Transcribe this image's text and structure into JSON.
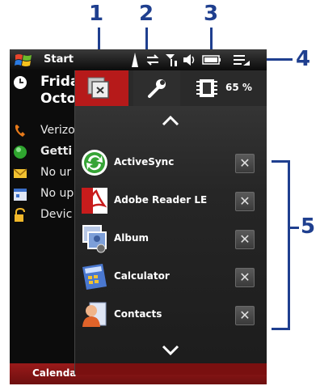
{
  "callouts": [
    "1",
    "2",
    "3",
    "4",
    "5"
  ],
  "statusbar": {
    "start_label": "Start"
  },
  "today": {
    "date_line1": "Frida",
    "date_line2": "Octo",
    "rows": [
      {
        "icon": "phone-icon",
        "text": "Verizo"
      },
      {
        "icon": "green-status-icon",
        "text": "Getti"
      },
      {
        "icon": "email-icon",
        "text": "No ur"
      },
      {
        "icon": "calendar-icon",
        "text": "No up"
      },
      {
        "icon": "lock-icon",
        "text": "Devic"
      }
    ],
    "bottom_label": "Calenda"
  },
  "task_manager": {
    "tabs": [
      {
        "name": "running-programs-tab",
        "icon": "window-close-icon"
      },
      {
        "name": "settings-tab",
        "icon": "wrench-icon"
      },
      {
        "name": "memory-tab",
        "icon": "memory-chip-icon",
        "label": "65 %"
      }
    ],
    "apps": [
      {
        "name": "ActiveSync",
        "icon": "activesync-icon"
      },
      {
        "name": "Adobe Reader LE",
        "icon": "adobe-reader-icon"
      },
      {
        "name": "Album",
        "icon": "album-icon"
      },
      {
        "name": "Calculator",
        "icon": "calculator-icon"
      },
      {
        "name": "Contacts",
        "icon": "contacts-icon"
      }
    ],
    "close_glyph": "✕"
  },
  "colors": {
    "accent_red": "#b61a1a",
    "callout_blue": "#1f3f8f"
  }
}
